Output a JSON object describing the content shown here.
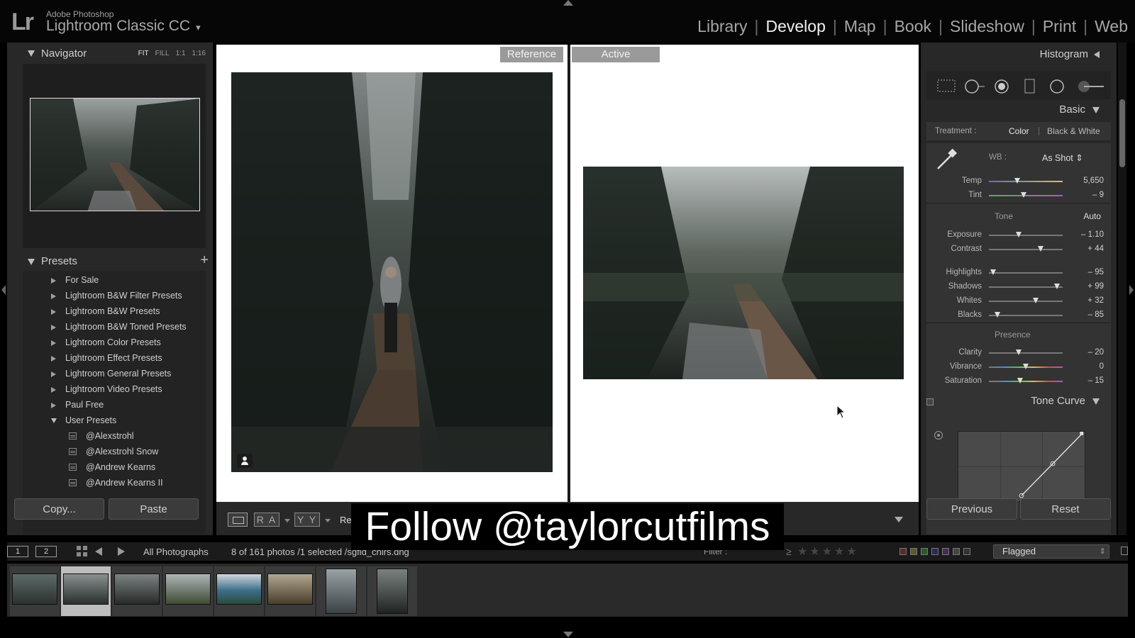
{
  "app": {
    "logo": "Lr",
    "vendor": "Adobe Photoshop",
    "product": "Lightroom Classic CC",
    "caret": "▾"
  },
  "modules": [
    "Library",
    "Develop",
    "Map",
    "Book",
    "Slideshow",
    "Print",
    "Web"
  ],
  "active_module": "Develop",
  "navigator": {
    "title": "Navigator",
    "zoom_options": [
      "FIT",
      "FILL",
      "1:1",
      "1:16"
    ],
    "selected_zoom": "FIT"
  },
  "presets": {
    "title": "Presets",
    "add": "+",
    "folders": [
      "For Sale",
      "Lightroom B&W Filter Presets",
      "Lightroom B&W Presets",
      "Lightroom B&W Toned Presets",
      "Lightroom Color Presets",
      "Lightroom Effect Presets",
      "Lightroom General Presets",
      "Lightroom Video Presets",
      "Paul Free",
      "User Presets"
    ],
    "user_presets": [
      "@Alexstrohl",
      "@Alexstrohl Snow",
      "@Andrew Kearns",
      "@Andrew Kearns II"
    ]
  },
  "left_buttons": {
    "copy": "Copy...",
    "paste": "Paste"
  },
  "compare": {
    "reference": "Reference",
    "active": "Active"
  },
  "toolbar": {
    "ra": "R A",
    "yy": "Y Y",
    "re": "Re"
  },
  "right_panel": {
    "histogram": "Histogram",
    "basic": "Basic",
    "treatment_label": "Treatment :",
    "treatment_color": "Color",
    "treatment_bw": "Black & White",
    "wb_label": "WB :",
    "wb_value": "As Shot ⇕",
    "tone_title": "Tone",
    "auto": "Auto",
    "presence_title": "Presence",
    "tone_curve": "Tone Curve",
    "wb_sliders": [
      {
        "label": "Temp",
        "value": "5,650",
        "pos": 0.38
      },
      {
        "label": "Tint",
        "value": "– 9",
        "pos": 0.47
      }
    ],
    "tone_sliders": [
      {
        "label": "Exposure",
        "value": "– 1.10",
        "pos": 0.4
      },
      {
        "label": "Contrast",
        "value": "+ 44",
        "pos": 0.7
      }
    ],
    "tone_sliders2": [
      {
        "label": "Highlights",
        "value": "– 95",
        "pos": 0.06
      },
      {
        "label": "Shadows",
        "value": "+ 99",
        "pos": 0.92
      },
      {
        "label": "Whites",
        "value": "+ 32",
        "pos": 0.63
      },
      {
        "label": "Blacks",
        "value": "– 85",
        "pos": 0.12
      }
    ],
    "presence_sliders": [
      {
        "label": "Clarity",
        "value": "– 20",
        "pos": 0.4
      },
      {
        "label": "Vibrance",
        "value": "0",
        "pos": 0.5
      },
      {
        "label": "Saturation",
        "value": "– 15",
        "pos": 0.42
      }
    ],
    "previous": "Previous",
    "reset": "Reset"
  },
  "filmstrip_bar": {
    "screen1": "1",
    "screen2": "2",
    "source": "All Photographs",
    "count": "8 of 161 photos /1 selected /sgfld_chirs.dng",
    "filter": "Filter :",
    "ge": "≥",
    "stars": "★★★★★",
    "flag_filter": "Flagged"
  },
  "caption": "Follow @taylorcutfilms",
  "colors": {
    "panel": "#282828",
    "accent_white": "#f0f0f0"
  }
}
